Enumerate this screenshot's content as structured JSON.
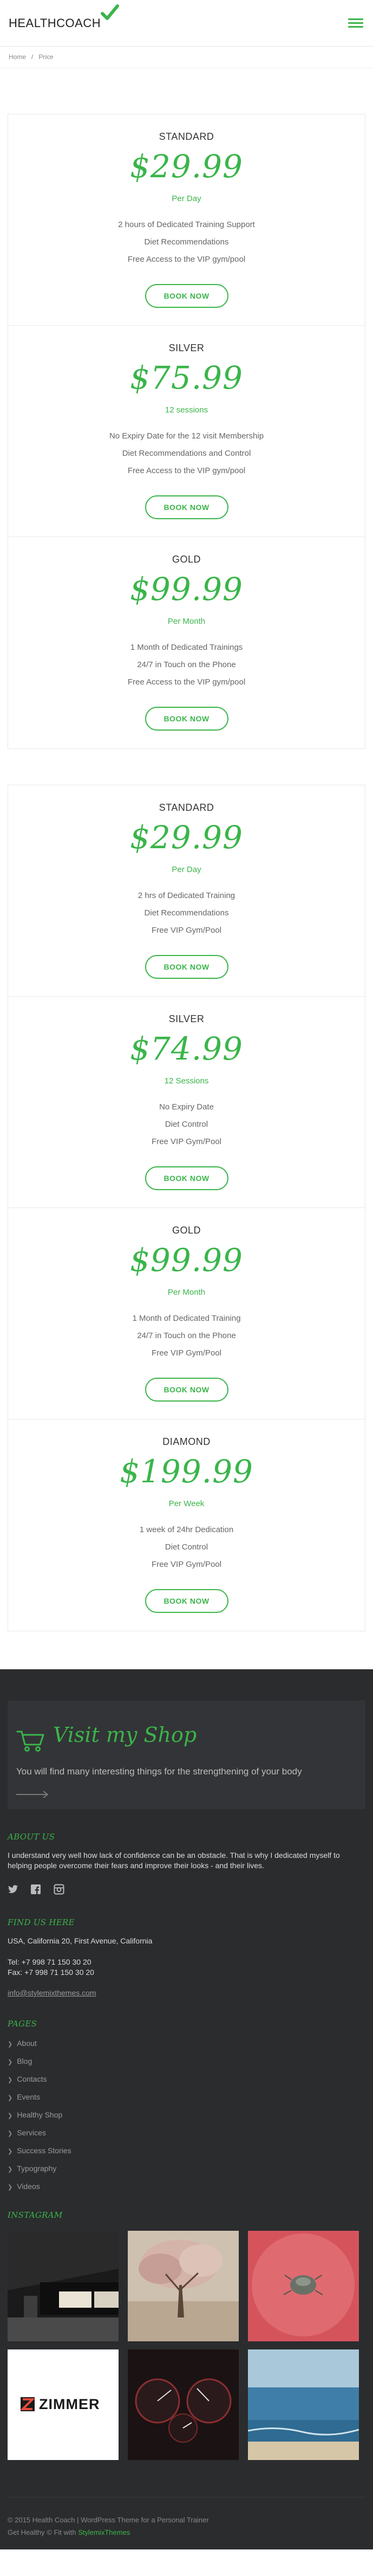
{
  "header": {
    "logo": "HEALTHCOACH",
    "menu_icon": "hamburger-icon"
  },
  "breadcrumb": {
    "home": "Home",
    "separator": "/",
    "current": "Price"
  },
  "colors": {
    "accent": "#3ab54a",
    "footer_bg": "#2b2c2e"
  },
  "pricing_groups": [
    {
      "plans": [
        {
          "name": "STANDARD",
          "price": "$29.99",
          "period": "Per Day",
          "features": [
            "2 hours of Dedicated Training Support",
            "Diet Recommendations",
            "Free Access to the VIP gym/pool"
          ],
          "button": "BOOK NOW"
        },
        {
          "name": "SILVER",
          "price": "$75.99",
          "period": "12 sessions",
          "features": [
            "No Expiry Date for the 12 visit Membership",
            "Diet Recommendations and Control",
            "Free Access to the VIP gym/pool"
          ],
          "button": "BOOK NOW"
        },
        {
          "name": "GOLD",
          "price": "$99.99",
          "period": "Per Month",
          "features": [
            "1 Month of Dedicated Trainings",
            "24/7 in Touch on the Phone",
            "Free Access to the VIP gym/pool"
          ],
          "button": "BOOK NOW"
        }
      ]
    },
    {
      "plans": [
        {
          "name": "STANDARD",
          "price": "$29.99",
          "period": "Per Day",
          "features": [
            "2 hrs of Dedicated Training",
            "Diet Recommendations",
            "Free VIP Gym/Pool"
          ],
          "button": "BOOK NOW"
        },
        {
          "name": "SILVER",
          "price": "$74.99",
          "period": "12 Sessions",
          "features": [
            "No Expiry Date",
            "Diet Control",
            "Free VIP Gym/Pool"
          ],
          "button": "BOOK NOW"
        },
        {
          "name": "GOLD",
          "price": "$99.99",
          "period": "Per Month",
          "features": [
            "1 Month of Dedicated Training",
            "24/7 in Touch on the Phone",
            "Free VIP Gym/Pool"
          ],
          "button": "BOOK NOW"
        },
        {
          "name": "DIAMOND",
          "price": "$199.99",
          "period": "Per Week",
          "features": [
            "1 week of 24hr Dedication",
            "Diet Control",
            "Free VIP Gym/Pool"
          ],
          "button": "BOOK NOW"
        }
      ]
    }
  ],
  "shop": {
    "title": "Visit my Shop",
    "description": "You will find many interesting things for the strengthening of your body"
  },
  "about": {
    "heading": "ABOUT US",
    "text": "I understand very well how lack of confidence can be an obstacle. That is why I dedicated myself to helping people overcome their fears and improve their looks - and their lives."
  },
  "find": {
    "heading": "FIND US HERE",
    "address": "USA, California 20, First Avenue, California",
    "tel": "Tel: +7 998 71 150 30 20",
    "fax": "Fax: +7 998 71 150 30 20",
    "email": "info@stylemixthemes.com"
  },
  "pages": {
    "heading": "PAGES",
    "items": [
      "About",
      "Blog",
      "Contacts",
      "Events",
      "Healthy Shop",
      "Services",
      "Success Stories",
      "Typography",
      "Videos"
    ]
  },
  "instagram": {
    "heading": "INSTAGRAM",
    "zimmer_label": "ZIMMER"
  },
  "copyright": {
    "line1": "© 2015 Health Coach | WordPress Theme for a Personal Trainer",
    "line2_prefix": "Get Healthy © Fit with ",
    "line2_link": "StylemixThemes"
  }
}
